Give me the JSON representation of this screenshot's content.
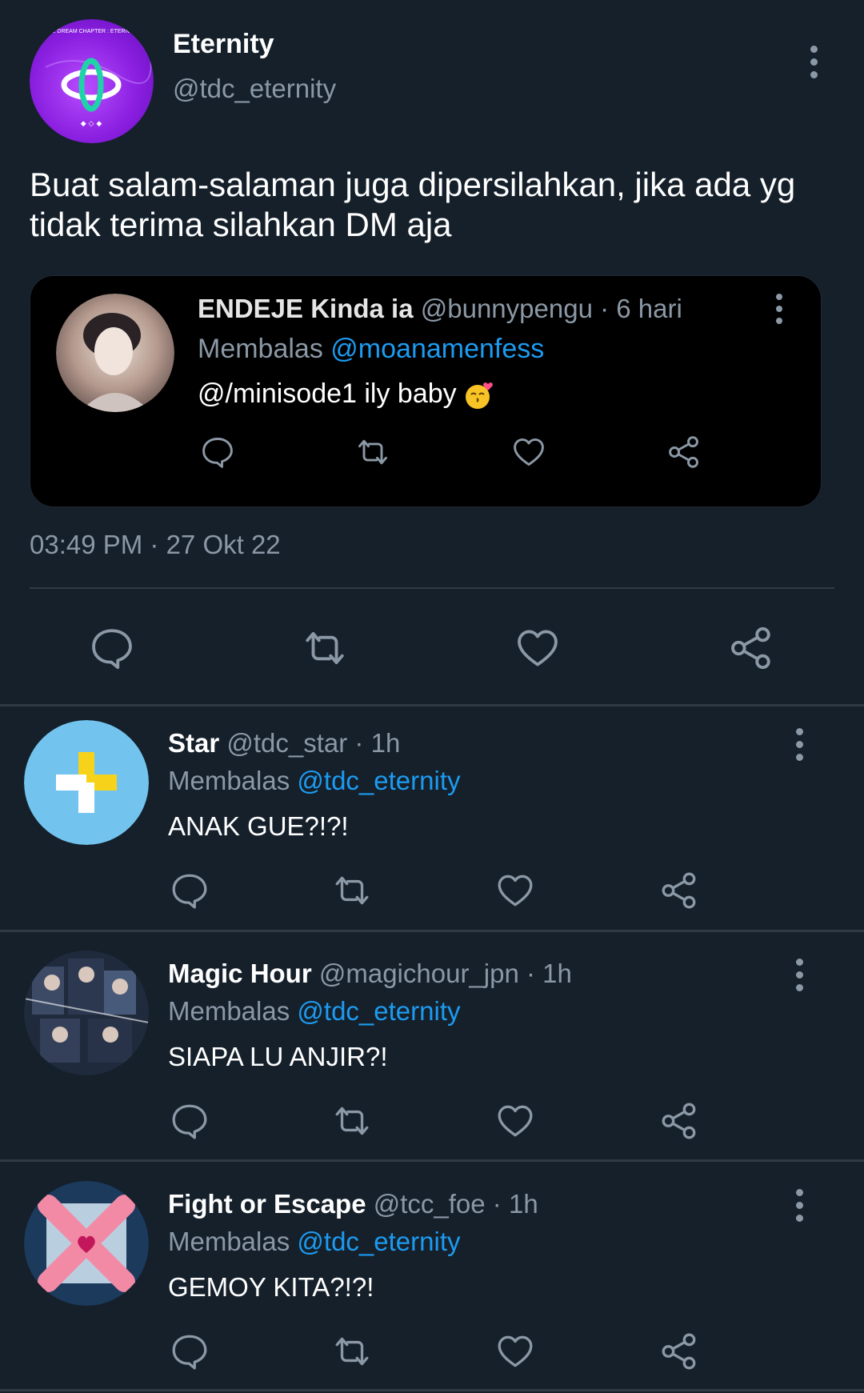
{
  "main_tweet": {
    "avatar_caption": "THE DREAM CHAPTER : ETERNITY",
    "name": "Eternity",
    "handle": "@tdc_eternity",
    "text": "Buat salam-salaman juga dipersilahkan, jika ada yg tidak terima silahkan DM aja",
    "timestamp": "03:49 PM · 27 Okt 22",
    "embedded": {
      "name": "ENDEJE Kinda ia",
      "handle": "@bunnypengu",
      "time": " · 6 hari",
      "reply_label": "Membalas",
      "reply_to": "@moanamenfess",
      "text": "@/minisode1 ily baby"
    }
  },
  "replies": [
    {
      "name": "Star",
      "handle": "@tdc_star",
      "time": " · 1h",
      "reply_label": "Membalas",
      "reply_to": "@tdc_eternity",
      "text": "ANAK GUE?!?!"
    },
    {
      "name": "Magic Hour",
      "handle": "@magichour_jpn",
      "time": " · 1h",
      "reply_label": "Membalas",
      "reply_to": "@tdc_eternity",
      "text": "SIAPA LU ANJIR?!"
    },
    {
      "name": "Fight or Escape",
      "handle": "@tcc_foe",
      "time": " · 1h",
      "reply_label": "Membalas",
      "reply_to": "@tdc_eternity",
      "text": "GEMOY KITA?!?!"
    }
  ],
  "icons": [
    "reply-icon",
    "retweet-icon",
    "like-icon",
    "share-icon",
    "more-options-icon"
  ],
  "colors": {
    "background": "#15202b",
    "card_background": "#000000",
    "accent": "#1d9bf0",
    "muted": "#8b98a5",
    "divider": "#2f3a45"
  }
}
